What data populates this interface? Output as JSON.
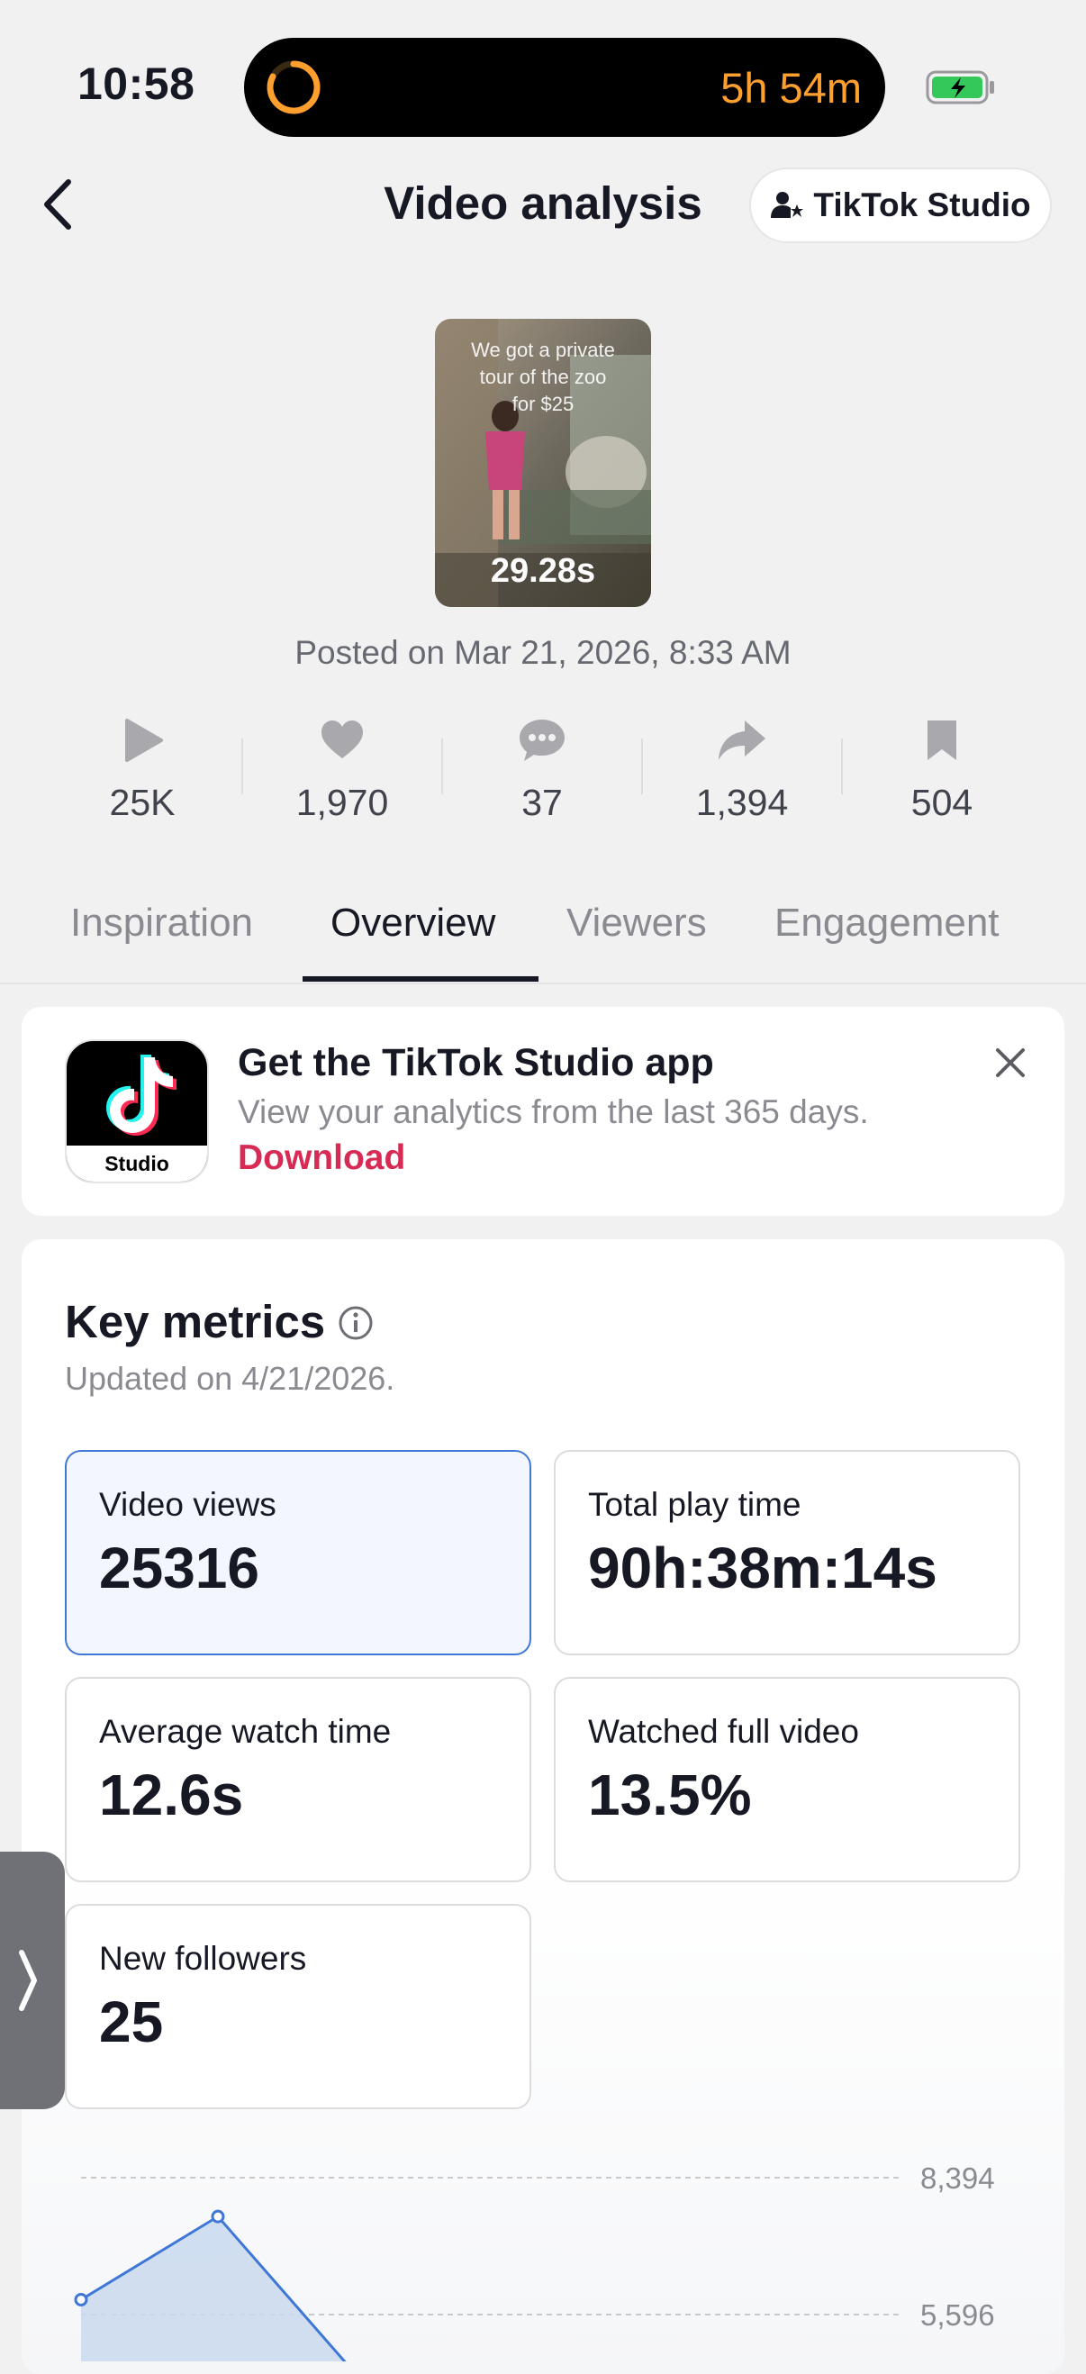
{
  "status": {
    "time": "10:58",
    "timer": "5h 54m"
  },
  "header": {
    "title": "Video analysis",
    "studio_button": "TikTok Studio"
  },
  "video": {
    "caption": "We got a private tour of the zoo for $25",
    "duration": "29.28s",
    "posted": "Posted on Mar 21, 2026, 8:33 AM"
  },
  "stats": [
    {
      "icon": "play-icon",
      "value": "25K"
    },
    {
      "icon": "heart-icon",
      "value": "1,970"
    },
    {
      "icon": "comment-icon",
      "value": "37"
    },
    {
      "icon": "share-icon",
      "value": "1,394"
    },
    {
      "icon": "bookmark-icon",
      "value": "504"
    }
  ],
  "tabs": [
    {
      "label": "Inspiration",
      "active": false
    },
    {
      "label": "Overview",
      "active": true
    },
    {
      "label": "Viewers",
      "active": false
    },
    {
      "label": "Engagement",
      "active": false
    }
  ],
  "promo": {
    "app_icon_label": "Studio",
    "title": "Get the TikTok Studio app",
    "subtitle": "View your analytics from the last 365 days.",
    "link": "Download"
  },
  "key_metrics": {
    "title": "Key metrics",
    "updated": "Updated on 4/21/2026.",
    "cards": [
      {
        "label": "Video views",
        "value": "25316",
        "selected": true
      },
      {
        "label": "Total play time",
        "value": "90h:38m:14s",
        "selected": false
      },
      {
        "label": "Average watch time",
        "value": "12.6s",
        "selected": false
      },
      {
        "label": "Watched full video",
        "value": "13.5%",
        "selected": false
      },
      {
        "label": "New followers",
        "value": "25",
        "selected": false
      }
    ]
  },
  "chart_data": {
    "type": "area",
    "y_ticks": [
      "8,394",
      "5,596"
    ],
    "y_tick_values": [
      8394,
      5596
    ],
    "series": [
      {
        "values": [
          5900,
          7600,
          4400
        ]
      }
    ],
    "color": "#3f77d6"
  },
  "colors": {
    "accent": "#d72a55",
    "selected_border": "#3f77d6",
    "timer": "#ff9f2e"
  }
}
